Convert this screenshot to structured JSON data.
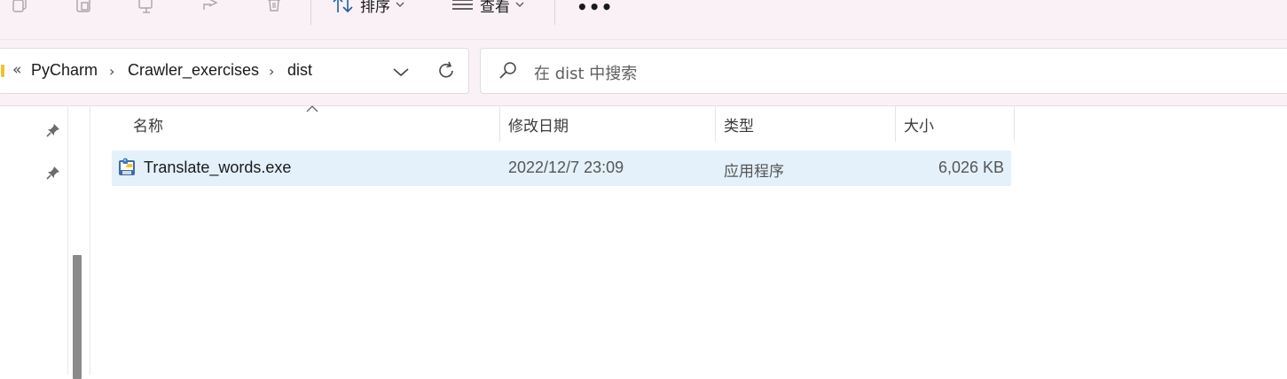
{
  "toolbar": {
    "icons": [
      "copy-icon",
      "paste-icon",
      "rename-icon",
      "share-icon",
      "delete-icon"
    ],
    "sort_label": "排序",
    "view_label": "查看",
    "more_label": "•••"
  },
  "address": {
    "overflow": "«",
    "separator": "›",
    "crumbs": [
      "PyCharm",
      "Crawler_exercises",
      "dist"
    ]
  },
  "search": {
    "placeholder": "在 dist 中搜索"
  },
  "columns": {
    "name": "名称",
    "date": "修改日期",
    "type": "类型",
    "size": "大小"
  },
  "files": [
    {
      "name": "Translate_words.exe",
      "date": "2022/12/7 23:09",
      "type": "应用程序",
      "size": "6,026 KB",
      "icon": "executable-icon"
    }
  ],
  "colors": {
    "chrome_bg": "#faf1f6",
    "selection_bg": "#e4f1fb"
  }
}
